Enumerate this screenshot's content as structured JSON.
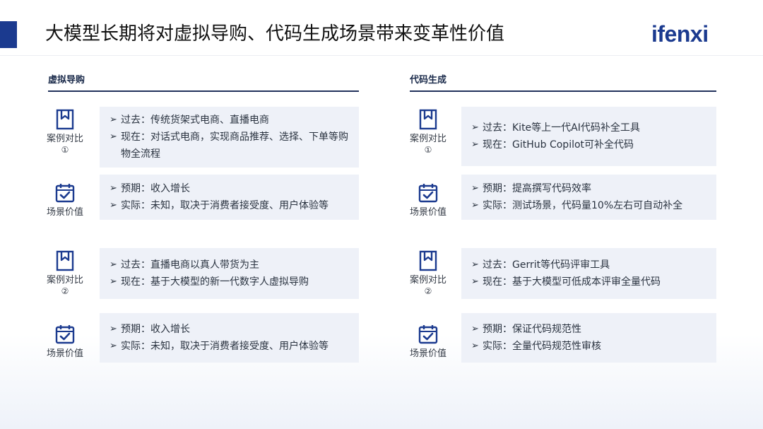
{
  "title": "大模型长期将对虚拟导购、代码生成场景带来变革性价值",
  "logo": "ifenxi",
  "colors": {
    "accent": "#1b3a8f",
    "box_bg": "#eef1f8",
    "rule": "#22325c"
  },
  "left": {
    "heading": "虚拟导购",
    "rows": [
      {
        "icon": "bookmark-icon",
        "label": "案例对比",
        "num": "①",
        "lines": [
          "过去：传统货架式电商、直播电商",
          "现在：对话式电商，实现商品推荐、选择、下单等购物全流程"
        ]
      },
      {
        "icon": "calendar-check-icon",
        "label": "场景价值",
        "num": "",
        "lines": [
          "预期：收入增长",
          "实际：未知，取决于消费者接受度、用户体验等"
        ]
      },
      {
        "icon": "bookmark-icon",
        "label": "案例对比",
        "num": "②",
        "lines": [
          "过去：直播电商以真人带货为主",
          "现在：基于大模型的新一代数字人虚拟导购"
        ]
      },
      {
        "icon": "calendar-check-icon",
        "label": "场景价值",
        "num": "",
        "lines": [
          "预期：收入增长",
          "实际：未知，取决于消费者接受度、用户体验等"
        ]
      }
    ]
  },
  "right": {
    "heading": "代码生成",
    "rows": [
      {
        "icon": "bookmark-icon",
        "label": "案例对比",
        "num": "①",
        "lines": [
          "过去：Kite等上一代AI代码补全工具",
          "现在：GitHub Copilot可补全代码"
        ]
      },
      {
        "icon": "calendar-check-icon",
        "label": "场景价值",
        "num": "",
        "lines": [
          "预期：提高撰写代码效率",
          "实际：测试场景，代码量10%左右可自动补全"
        ]
      },
      {
        "icon": "bookmark-icon",
        "label": "案例对比",
        "num": "②",
        "lines": [
          "过去：Gerrit等代码评审工具",
          "现在：基于大模型可低成本评审全量代码"
        ]
      },
      {
        "icon": "calendar-check-icon",
        "label": "场景价值",
        "num": "",
        "lines": [
          "预期：保证代码规范性",
          "实际：全量代码规范性审核"
        ]
      }
    ]
  }
}
